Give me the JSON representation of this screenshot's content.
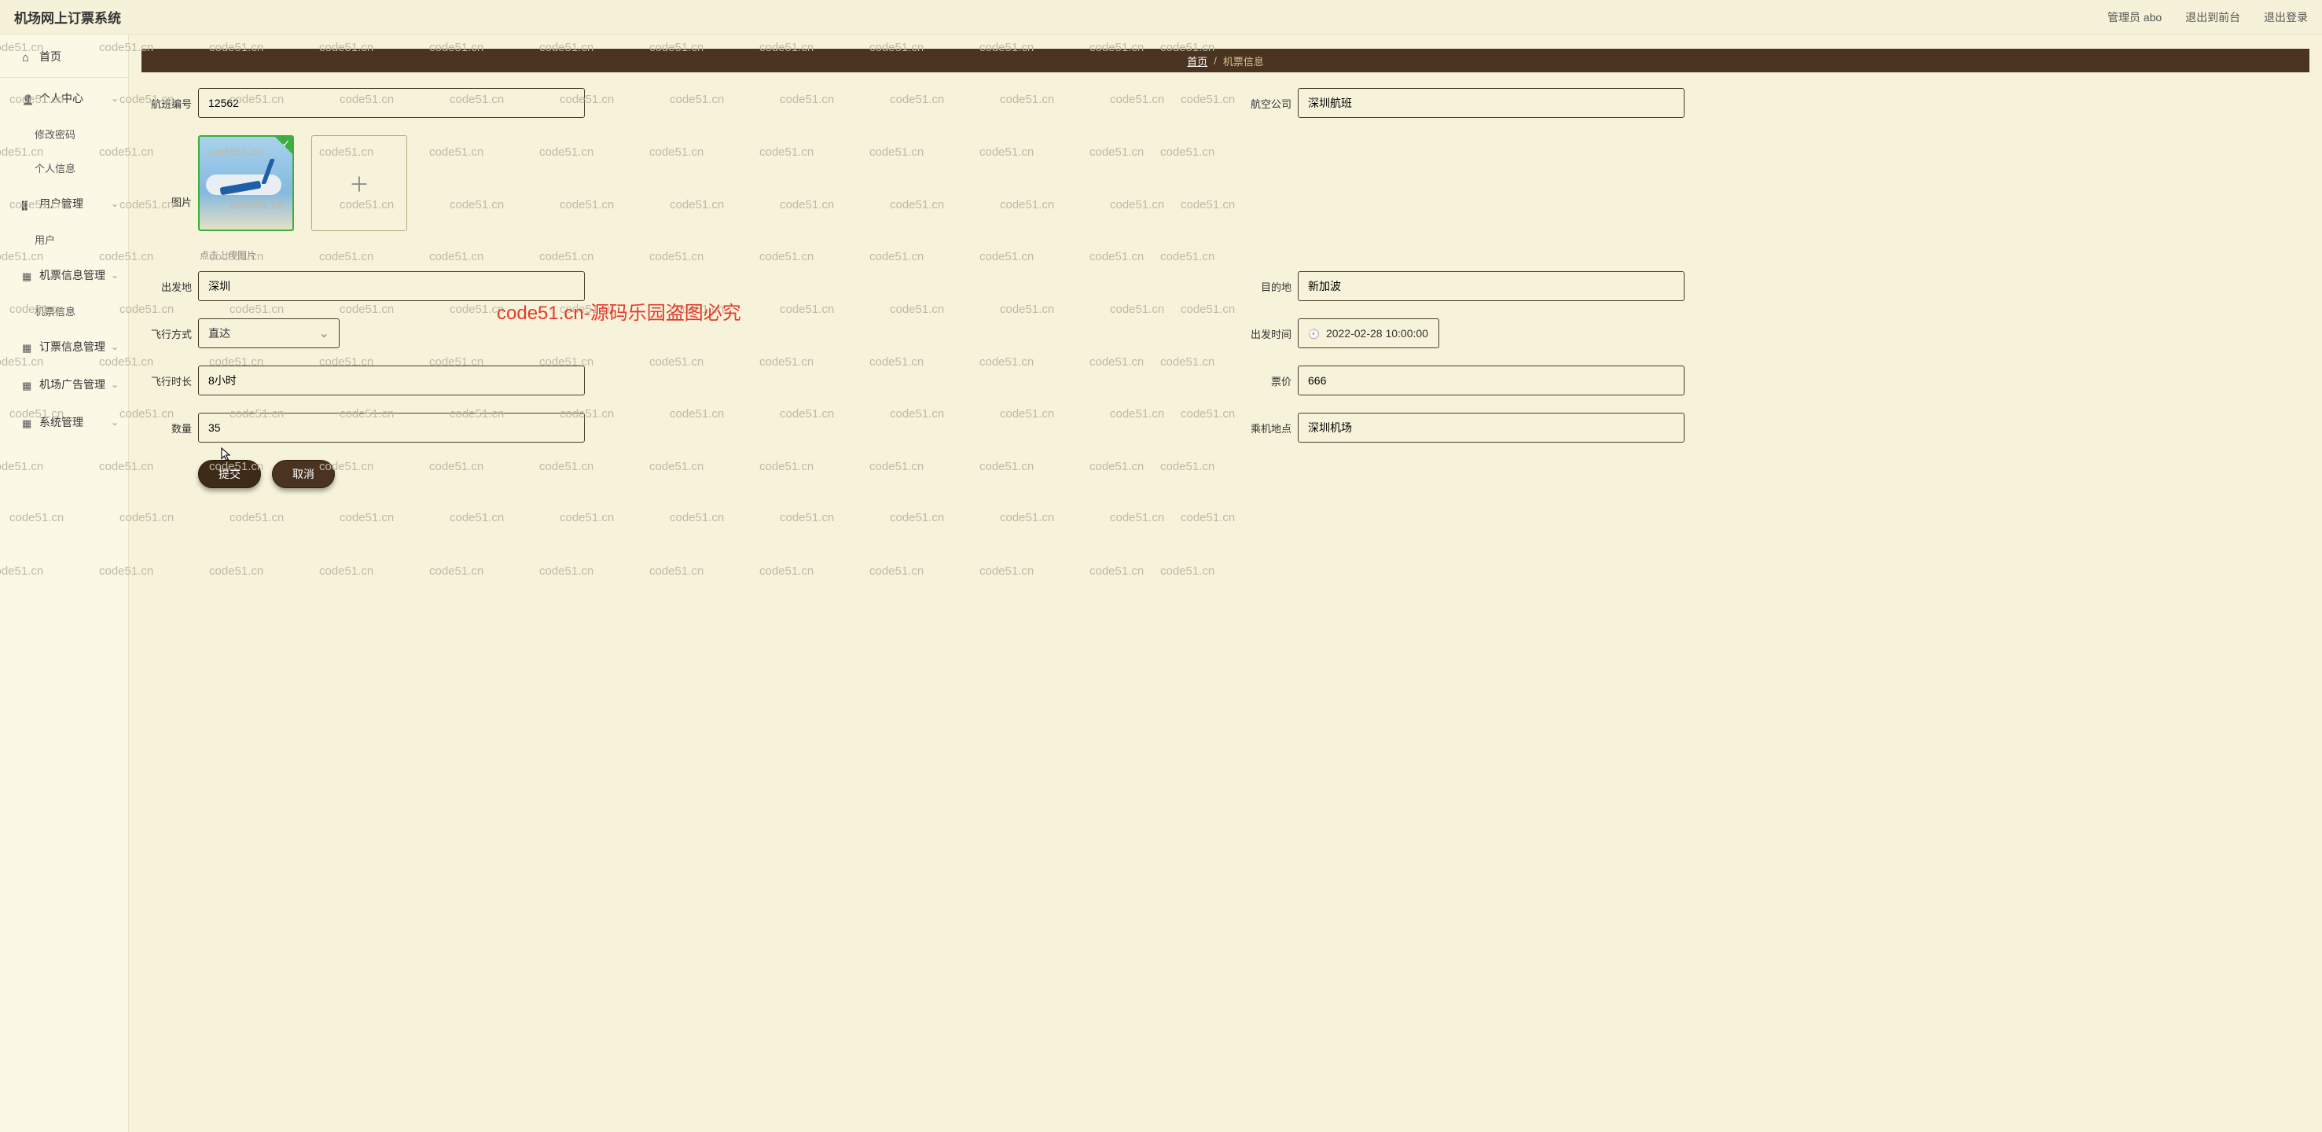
{
  "topbar": {
    "title": "机场网上订票系统",
    "admin_label": "管理员 abo",
    "front_link": "退出到前台",
    "logout_link": "退出登录"
  },
  "sidebar": {
    "items": [
      {
        "label": "首页",
        "icon": "home"
      },
      {
        "label": "个人中心",
        "icon": "user",
        "chev": true
      },
      {
        "label": "修改密码",
        "sub": true
      },
      {
        "label": "个人信息",
        "sub": true
      },
      {
        "label": "用户管理",
        "icon": "bars",
        "chev": true
      },
      {
        "label": "用户",
        "sub": true
      },
      {
        "label": "机票信息管理",
        "icon": "grid",
        "chev": true
      },
      {
        "label": "机票信息",
        "sub": true
      },
      {
        "label": "订票信息管理",
        "icon": "grid",
        "chev": true
      },
      {
        "label": "机场广告管理",
        "icon": "grid",
        "chev": true
      },
      {
        "label": "系统管理",
        "icon": "grid",
        "chev": true
      }
    ]
  },
  "crumb": {
    "home": "首页",
    "sep": "/",
    "current": "机票信息"
  },
  "form": {
    "flight_no_label": "航班编号",
    "flight_no": "12562",
    "airline_label": "航空公司",
    "airline": "深圳航班",
    "image_label": "图片",
    "upload_hint": "点击上传图片",
    "origin_label": "出发地",
    "origin": "深圳",
    "dest_label": "目的地",
    "dest": "新加波",
    "mode_label": "飞行方式",
    "mode": "直达",
    "depart_label": "出发时间",
    "depart": "2022-02-28 10:00:00",
    "duration_label": "飞行时长",
    "duration": "8小时",
    "price_label": "票价",
    "price": "666",
    "qty_label": "数量",
    "qty": "35",
    "board_label": "乘机地点",
    "board": "深圳机场",
    "submit": "提交",
    "cancel": "取消"
  },
  "watermark": {
    "text": "code51.cn",
    "red": "code51.cn-源码乐园盗图必究"
  }
}
